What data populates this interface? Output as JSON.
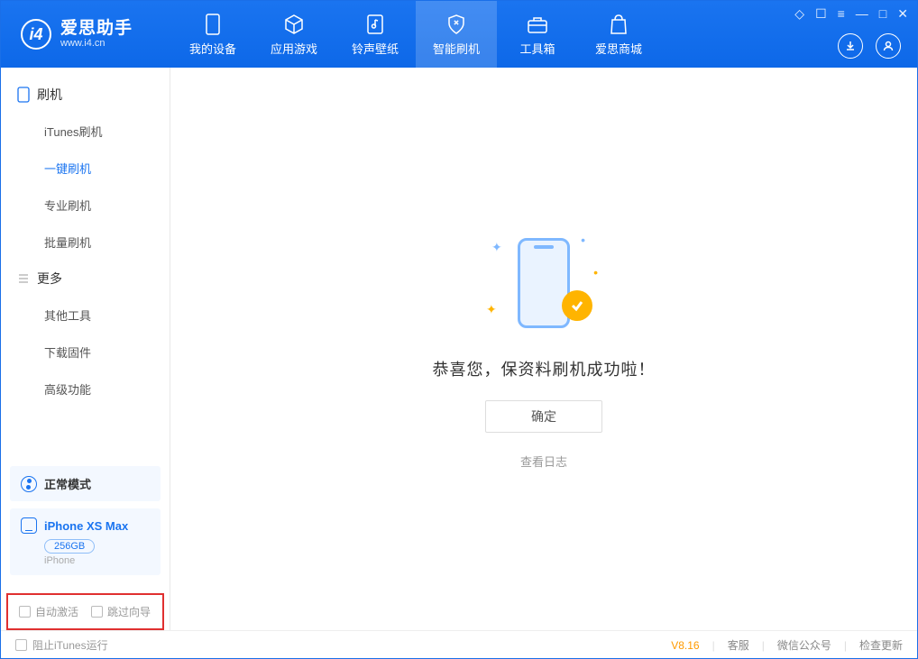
{
  "app": {
    "name_cn": "爱思助手",
    "name_en": "www.i4.cn"
  },
  "nav": [
    {
      "label": "我的设备"
    },
    {
      "label": "应用游戏"
    },
    {
      "label": "铃声壁纸"
    },
    {
      "label": "智能刷机"
    },
    {
      "label": "工具箱"
    },
    {
      "label": "爱思商城"
    }
  ],
  "sidebar": {
    "group1": {
      "title": "刷机",
      "items": [
        "iTunes刷机",
        "一键刷机",
        "专业刷机",
        "批量刷机"
      ],
      "active": 1
    },
    "group2": {
      "title": "更多",
      "items": [
        "其他工具",
        "下载固件",
        "高级功能"
      ]
    },
    "mode_label": "正常模式",
    "device": {
      "name": "iPhone XS Max",
      "capacity": "256GB",
      "type": "iPhone"
    },
    "check1": "自动激活",
    "check2": "跳过向导"
  },
  "main": {
    "message": "恭喜您，保资料刷机成功啦！",
    "ok": "确定",
    "view_log": "查看日志"
  },
  "footer": {
    "block_itunes": "阻止iTunes运行",
    "version": "V8.16",
    "links": [
      "客服",
      "微信公众号",
      "检查更新"
    ]
  }
}
